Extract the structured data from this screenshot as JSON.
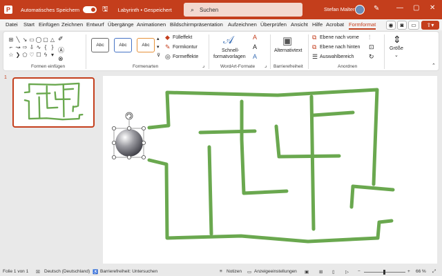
{
  "titlebar": {
    "autosave_label": "Automatisches Speichern",
    "doc_title": "Labyrinth • Gespeichert",
    "search_placeholder": "Suchen",
    "user_name": "Stefan Malter"
  },
  "menu": {
    "tabs": [
      "Datei",
      "Start",
      "Einfügen",
      "Zeichnen",
      "Entwurf",
      "Übergänge",
      "Animationen",
      "Bildschirmpräsentation",
      "Aufzeichnen",
      "Überprüfen",
      "Ansicht",
      "Hilfe",
      "Acrobat",
      "Formformat"
    ],
    "active_tab": "Formformat"
  },
  "ribbon": {
    "groups": {
      "insert_shapes": "Formen einfügen",
      "shape_styles": "Formenarten",
      "wordart_styles": "WordArt-Formate",
      "accessibility": "Barrierefreiheit",
      "arrange": "Anordnen"
    },
    "style_presets": [
      "Abc",
      "Abc",
      "Abc"
    ],
    "fill_label": "Fülleffekt",
    "outline_label": "Formkontur",
    "effects_label": "Formeffekte",
    "quick_styles_line1": "Schnell-",
    "quick_styles_line2": "formatvorlagen",
    "alt_text_label": "Alternativtext",
    "bring_forward_label": "Ebene nach vorne",
    "send_backward_label": "Ebene nach hinten",
    "selection_pane_label": "Auswahlbereich",
    "size_label": "Größe"
  },
  "thumbnails": {
    "slide_number": "1"
  },
  "statusbar": {
    "slide_info": "Folie 1 von 1",
    "language": "Deutsch (Deutschland)",
    "accessibility": "Barrierefreiheit: Untersuchen",
    "notes": "Notizen",
    "display_settings": "Anzeigeeinstellungen",
    "zoom": "66 %"
  },
  "colors": {
    "accent": "#c43e1c",
    "maze_line": "#6aa84f"
  }
}
